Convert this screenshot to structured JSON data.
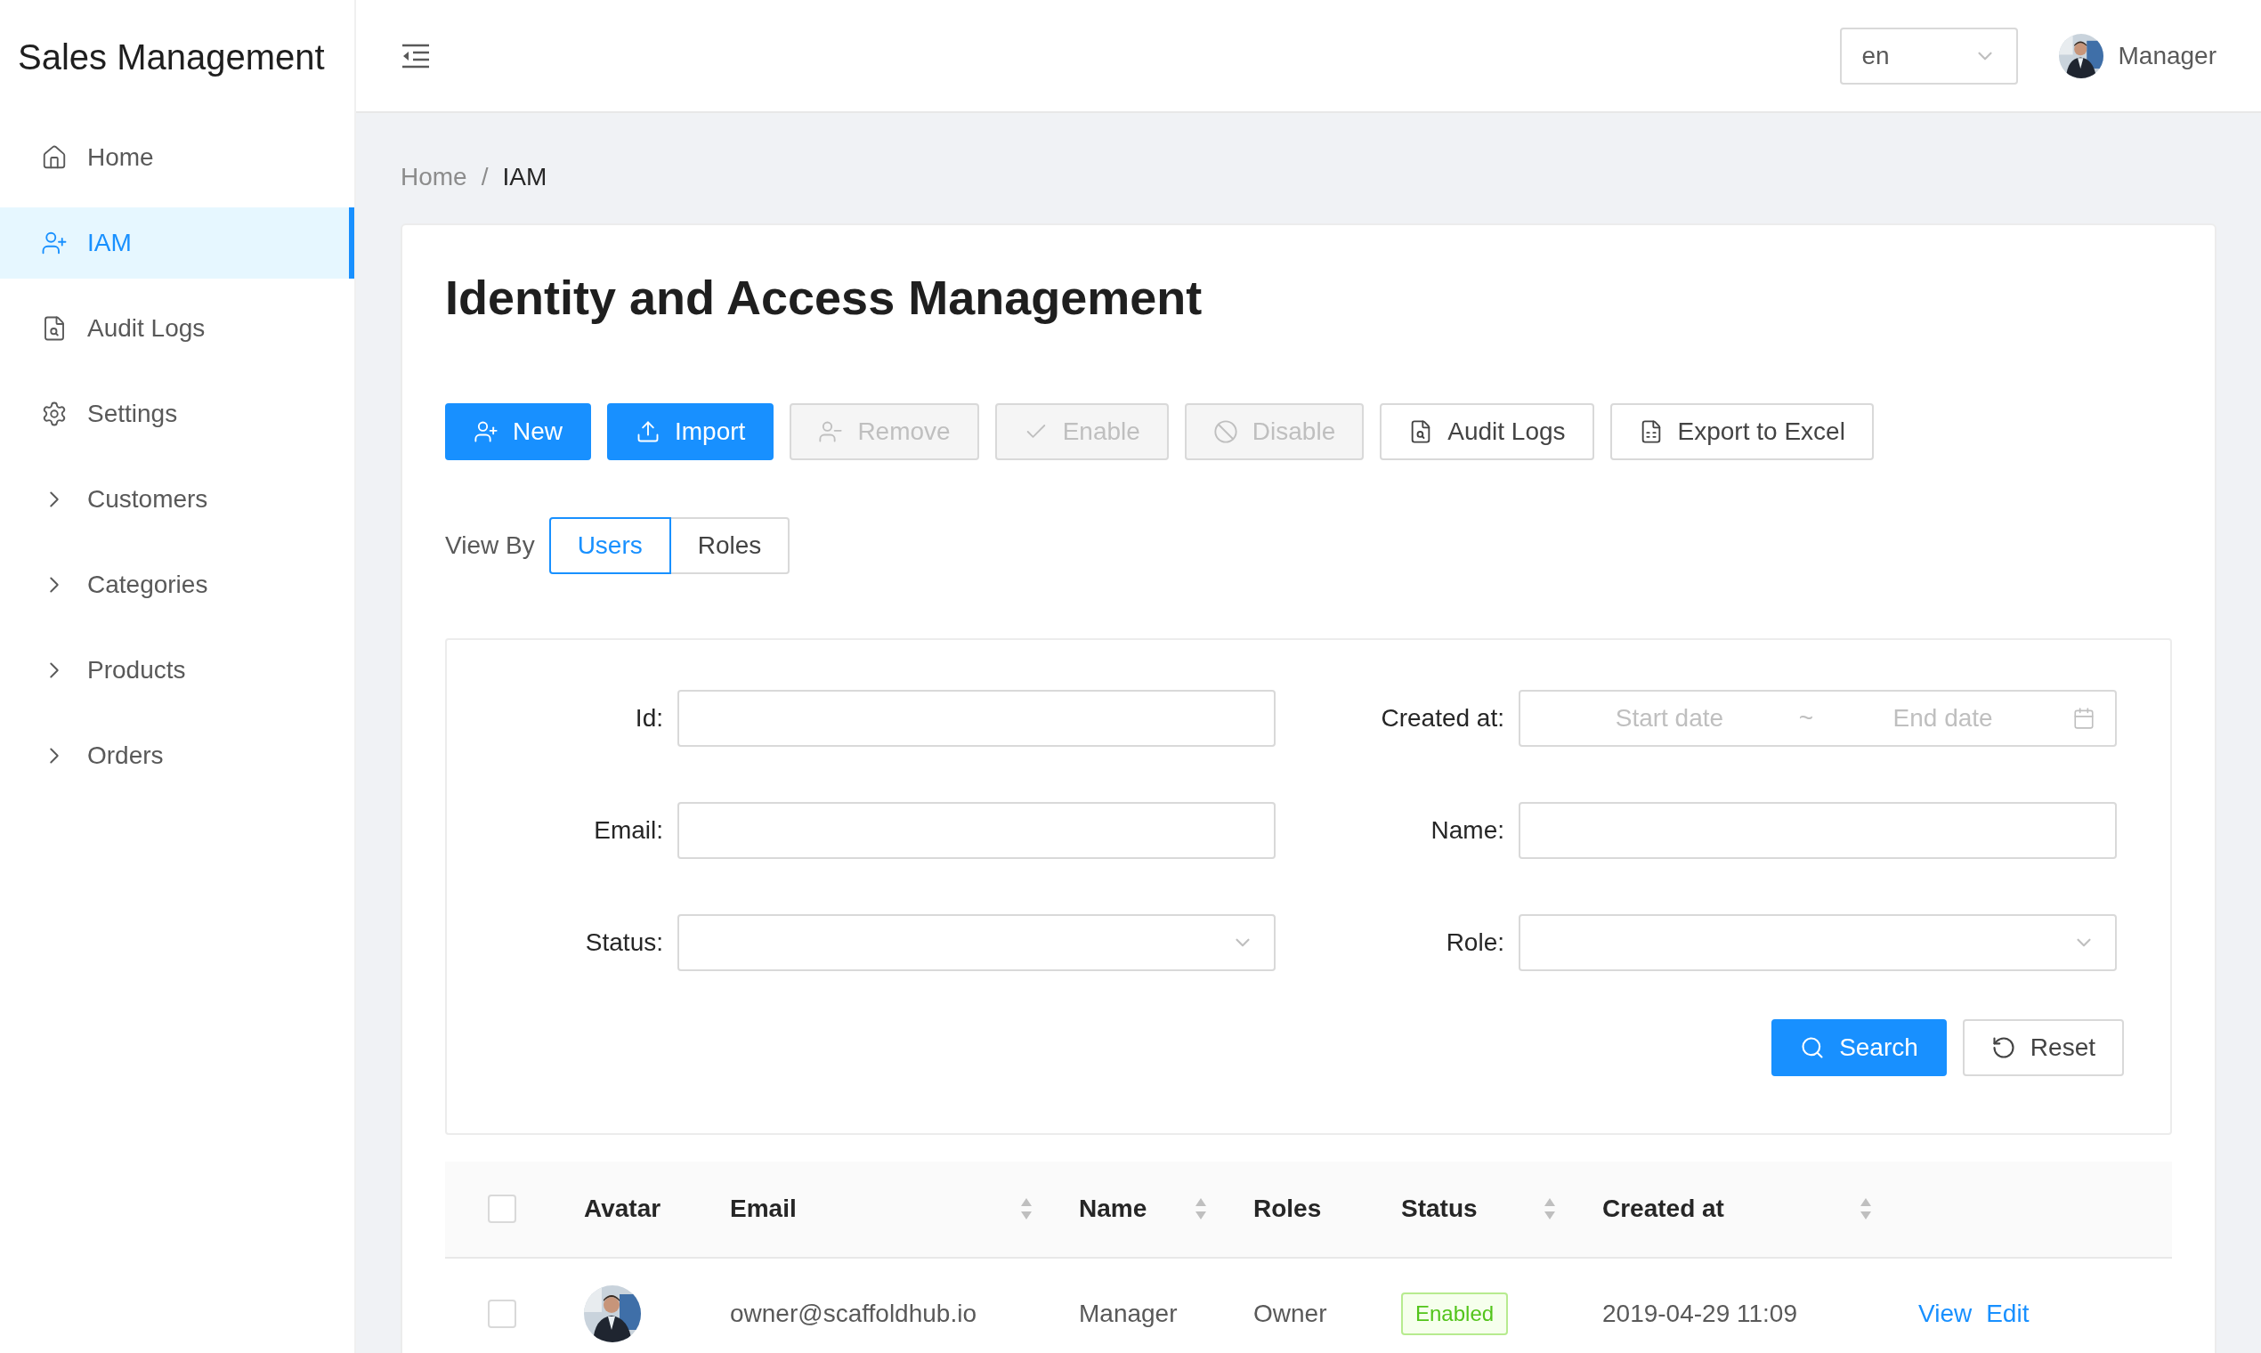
{
  "app": {
    "title": "Sales Management"
  },
  "sidebar": {
    "items": [
      {
        "label": "Home",
        "kind": "link",
        "selected": false
      },
      {
        "label": "IAM",
        "kind": "link",
        "selected": true
      },
      {
        "label": "Audit Logs",
        "kind": "link",
        "selected": false
      },
      {
        "label": "Settings",
        "kind": "link",
        "selected": false
      },
      {
        "label": "Customers",
        "kind": "group",
        "selected": false
      },
      {
        "label": "Categories",
        "kind": "group",
        "selected": false
      },
      {
        "label": "Products",
        "kind": "group",
        "selected": false
      },
      {
        "label": "Orders",
        "kind": "group",
        "selected": false
      }
    ]
  },
  "header": {
    "language": {
      "value": "en"
    },
    "user": {
      "name": "Manager"
    }
  },
  "breadcrumb": {
    "items": [
      "Home",
      "IAM"
    ],
    "separator": "/"
  },
  "page": {
    "title": "Identity and Access Management"
  },
  "toolbar": [
    {
      "label": "New",
      "kind": "primary",
      "disabled": false
    },
    {
      "label": "Import",
      "kind": "primary",
      "disabled": false
    },
    {
      "label": "Remove",
      "disabled": true
    },
    {
      "label": "Enable",
      "disabled": true
    },
    {
      "label": "Disable",
      "disabled": true
    },
    {
      "label": "Audit Logs",
      "kind": "default",
      "disabled": false
    },
    {
      "label": "Export to Excel",
      "kind": "default",
      "disabled": false
    }
  ],
  "view_by": {
    "label": "View By",
    "options": [
      {
        "label": "Users",
        "selected": true
      },
      {
        "label": "Roles",
        "selected": false
      }
    ]
  },
  "filters": {
    "fields": [
      {
        "label": "Id:",
        "kind": "text"
      },
      {
        "label": "Created at:",
        "kind": "daterange",
        "start_placeholder": "Start date",
        "separator": "~",
        "end_placeholder": "End date"
      },
      {
        "label": "Email:",
        "kind": "text"
      },
      {
        "label": "Name:",
        "kind": "text"
      },
      {
        "label": "Status:",
        "kind": "select"
      },
      {
        "label": "Role:",
        "kind": "select"
      }
    ],
    "buttons": [
      {
        "label": "Search",
        "kind": "primary"
      },
      {
        "label": "Reset",
        "kind": "default"
      }
    ]
  },
  "table": {
    "select_all": {
      "checked": false
    },
    "columns": [
      {
        "label": "Avatar",
        "sortable": false
      },
      {
        "label": "Email",
        "sortable": true
      },
      {
        "label": "Name",
        "sortable": true
      },
      {
        "label": "Roles",
        "sortable": false
      },
      {
        "label": "Status",
        "sortable": true
      },
      {
        "label": "Created at",
        "sortable": true
      }
    ],
    "rows": [
      {
        "checked": false,
        "email": "owner@scaffoldhub.io",
        "name": "Manager",
        "roles": "Owner",
        "status": {
          "label": "Enabled",
          "kind": "enabled"
        },
        "created_at": "2019-04-29 11:09",
        "actions": [
          "View",
          "Edit"
        ]
      }
    ]
  }
}
